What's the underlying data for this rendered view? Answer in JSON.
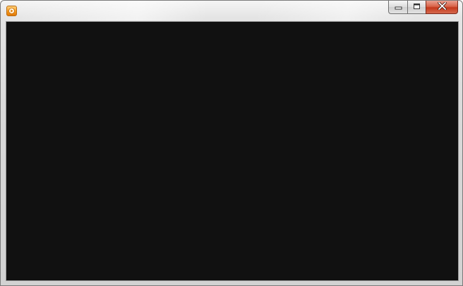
{
  "window": {
    "title": "",
    "app_icon": "media-player-icon",
    "colors": {
      "frame": "#d9d9d9",
      "client_background": "#111111",
      "close_button": "#c4391b"
    }
  },
  "caption_buttons": {
    "minimize": "minimize-icon",
    "maximize": "maximize-icon",
    "close": "close-icon"
  }
}
